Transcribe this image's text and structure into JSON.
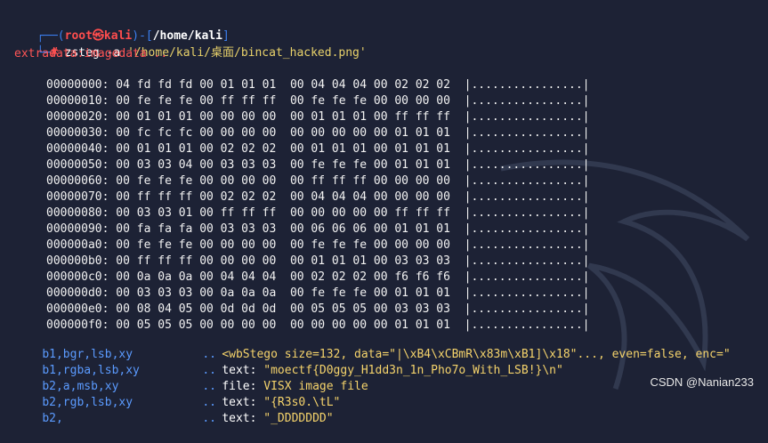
{
  "prompt": {
    "corner_top": "┌──(",
    "user": "root㉿kali",
    "close_paren": ")-[",
    "cwd": "/home/kali",
    "close_bracket": "]",
    "corner_bottom": "└─",
    "hash": "#",
    "command": "zsteg -a",
    "path_arg": "'/home/kali/桌面/bincat_hacked.png'"
  },
  "extradata_line": "extradata:imagedata ..",
  "hexdump": [
    {
      "offset": "00000000:",
      "bytes": "04 fd fd fd 00 01 01 01  00 04 04 04 00 02 02 02",
      "ascii": "|................|"
    },
    {
      "offset": "00000010:",
      "bytes": "00 fe fe fe 00 ff ff ff  00 fe fe fe 00 00 00 00",
      "ascii": "|................|"
    },
    {
      "offset": "00000020:",
      "bytes": "00 01 01 01 00 00 00 00  00 01 01 01 00 ff ff ff",
      "ascii": "|................|"
    },
    {
      "offset": "00000030:",
      "bytes": "00 fc fc fc 00 00 00 00  00 00 00 00 00 01 01 01",
      "ascii": "|................|"
    },
    {
      "offset": "00000040:",
      "bytes": "00 01 01 01 00 02 02 02  00 01 01 01 00 01 01 01",
      "ascii": "|................|"
    },
    {
      "offset": "00000050:",
      "bytes": "00 03 03 04 00 03 03 03  00 fe fe fe 00 01 01 01",
      "ascii": "|................|"
    },
    {
      "offset": "00000060:",
      "bytes": "00 fe fe fe 00 00 00 00  00 ff ff ff 00 00 00 00",
      "ascii": "|................|"
    },
    {
      "offset": "00000070:",
      "bytes": "00 ff ff ff 00 02 02 02  00 04 04 04 00 00 00 00",
      "ascii": "|................|"
    },
    {
      "offset": "00000080:",
      "bytes": "00 03 03 01 00 ff ff ff  00 00 00 00 00 ff ff ff",
      "ascii": "|................|"
    },
    {
      "offset": "00000090:",
      "bytes": "00 fa fa fa 00 03 03 03  00 06 06 06 00 01 01 01",
      "ascii": "|................|"
    },
    {
      "offset": "000000a0:",
      "bytes": "00 fe fe fe 00 00 00 00  00 fe fe fe 00 00 00 00",
      "ascii": "|................|"
    },
    {
      "offset": "000000b0:",
      "bytes": "00 ff ff ff 00 00 00 00  00 01 01 01 00 03 03 03",
      "ascii": "|................|"
    },
    {
      "offset": "000000c0:",
      "bytes": "00 0a 0a 0a 00 04 04 04  00 02 02 02 00 f6 f6 f6",
      "ascii": "|................|"
    },
    {
      "offset": "000000d0:",
      "bytes": "00 03 03 03 00 0a 0a 0a  00 fe fe fe 00 01 01 01",
      "ascii": "|................|"
    },
    {
      "offset": "000000e0:",
      "bytes": "00 08 04 05 00 0d 0d 0d  00 05 05 05 00 03 03 03",
      "ascii": "|................|"
    },
    {
      "offset": "000000f0:",
      "bytes": "00 05 05 05 00 00 00 00  00 00 00 00 00 01 01 01",
      "ascii": "|................|"
    }
  ],
  "results": [
    {
      "key": "b1,bgr,lsb,xy",
      "dots": "..",
      "label": "",
      "value": "<wbStego size=132, data=\"|\\xB4\\xCBmR\\x83m\\xB1]\\x18\"..., even=false, enc=\""
    },
    {
      "key": "b1,rgba,lsb,xy",
      "dots": "..",
      "label": "text: ",
      "value": "\"moectf{D0ggy_H1dd3n_1n_Pho7o_With_LSB!}\\n\""
    },
    {
      "key": "b2,a,msb,xy",
      "dots": "..",
      "label": "file: ",
      "value": "VISX image file"
    },
    {
      "key": "b2,rgb,lsb,xy",
      "dots": "..",
      "label": "text: ",
      "value": "\"{R3s0.\\tL\""
    },
    {
      "key": "b2,",
      "dots": "..",
      "label": "text: ",
      "value": "\"_DDDDDDD\""
    }
  ],
  "watermark": "CSDN @Nanian233",
  "colors": {
    "background": "#1d2235",
    "prompt_user": "#ff4d4d",
    "prompt_frame": "#3b7ff0",
    "string": "#e8d16a",
    "result_key": "#5b9bff"
  }
}
